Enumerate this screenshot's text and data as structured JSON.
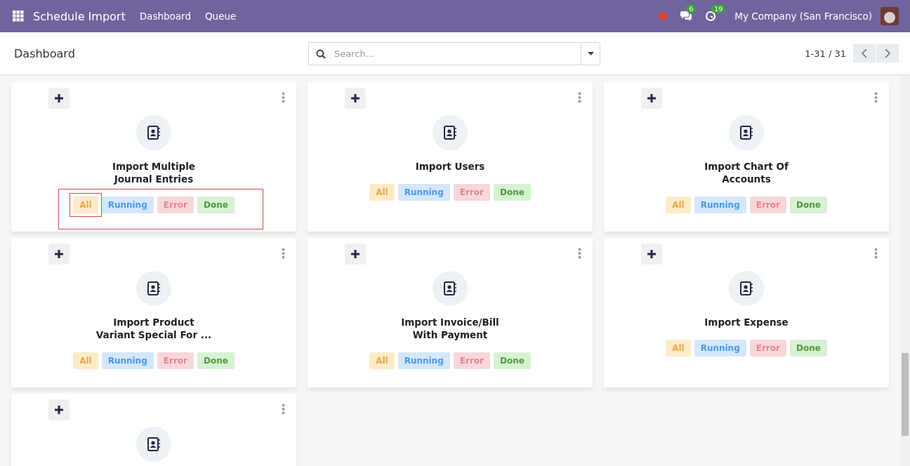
{
  "navbar": {
    "app_title": "Schedule Import",
    "menu": [
      {
        "label": "Dashboard"
      },
      {
        "label": "Queue"
      }
    ],
    "messages_count": "6",
    "activities_count": "19",
    "company": "My Company (San Francisco)"
  },
  "control_panel": {
    "breadcrumb": "Dashboard",
    "search": {
      "placeholder": "Search..."
    },
    "pager": "1-31 / 31"
  },
  "cards": [
    {
      "kind": "full",
      "title": [
        "Import Multiple",
        "Journal Entries"
      ],
      "highlighted": true,
      "filters": [
        {
          "kind": "all",
          "label": "All",
          "highlighted": true
        },
        {
          "kind": "running",
          "label": "Running",
          "highlighted": false
        },
        {
          "kind": "error",
          "label": "Error",
          "highlighted": false
        },
        {
          "kind": "done",
          "label": "Done",
          "highlighted": false
        }
      ]
    },
    {
      "kind": "full",
      "title": [
        "Import Users"
      ],
      "highlighted": false,
      "filters": [
        {
          "kind": "all",
          "label": "All",
          "highlighted": false
        },
        {
          "kind": "running",
          "label": "Running",
          "highlighted": false
        },
        {
          "kind": "error",
          "label": "Error",
          "highlighted": false
        },
        {
          "kind": "done",
          "label": "Done",
          "highlighted": false
        }
      ]
    },
    {
      "kind": "full",
      "title": [
        "Import Chart Of",
        "Accounts"
      ],
      "highlighted": false,
      "filters": [
        {
          "kind": "all",
          "label": "All",
          "highlighted": false
        },
        {
          "kind": "running",
          "label": "Running",
          "highlighted": false
        },
        {
          "kind": "error",
          "label": "Error",
          "highlighted": false
        },
        {
          "kind": "done",
          "label": "Done",
          "highlighted": false
        }
      ]
    },
    {
      "kind": "full",
      "title": [
        "Import Product",
        "Variant Special For ..."
      ],
      "highlighted": false,
      "filters": [
        {
          "kind": "all",
          "label": "All",
          "highlighted": false
        },
        {
          "kind": "running",
          "label": "Running",
          "highlighted": false
        },
        {
          "kind": "error",
          "label": "Error",
          "highlighted": false
        },
        {
          "kind": "done",
          "label": "Done",
          "highlighted": false
        }
      ]
    },
    {
      "kind": "full",
      "title": [
        "Import Invoice/Bill",
        "With Payment"
      ],
      "highlighted": false,
      "filters": [
        {
          "kind": "all",
          "label": "All",
          "highlighted": false
        },
        {
          "kind": "running",
          "label": "Running",
          "highlighted": false
        },
        {
          "kind": "error",
          "label": "Error",
          "highlighted": false
        },
        {
          "kind": "done",
          "label": "Done",
          "highlighted": false
        }
      ]
    },
    {
      "kind": "full",
      "title": [
        "Import Expense"
      ],
      "highlighted": false,
      "filters": [
        {
          "kind": "all",
          "label": "All",
          "highlighted": false
        },
        {
          "kind": "running",
          "label": "Running",
          "highlighted": false
        },
        {
          "kind": "error",
          "label": "Error",
          "highlighted": false
        },
        {
          "kind": "done",
          "label": "Done",
          "highlighted": false
        }
      ]
    },
    {
      "kind": "cut_off"
    }
  ]
}
